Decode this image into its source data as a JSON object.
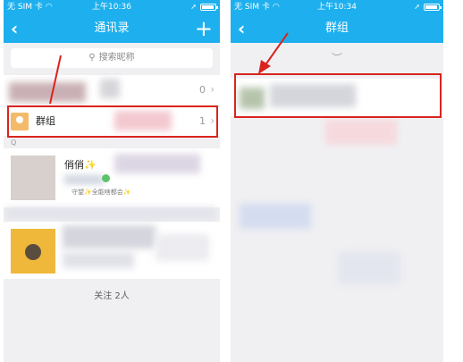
{
  "left_phone": {
    "status": {
      "carrier": "无 SIM 卡",
      "wifi_icon": "wifi-icon",
      "time": "上午10:36"
    },
    "nav": {
      "back_icon": "chevron-left",
      "title": "通讯录",
      "add_icon": "plus"
    },
    "search": {
      "placeholder": "搜索昵称",
      "icon": "search-icon"
    },
    "partial_count": "0",
    "group_row": {
      "label": "群组",
      "count": "1"
    },
    "section_letter": "Q",
    "contact": {
      "name": "俏俏✨",
      "signature": "守望✨全能啥都会✨"
    },
    "footer": {
      "follow_count": "关注 2人"
    }
  },
  "right_phone": {
    "status": {
      "carrier": "无 SIM 卡",
      "wifi_icon": "wifi-icon",
      "time": "上午10:34"
    },
    "nav": {
      "back_icon": "chevron-left",
      "title": "群组"
    }
  },
  "annotation": {
    "color": "#d9241e"
  }
}
